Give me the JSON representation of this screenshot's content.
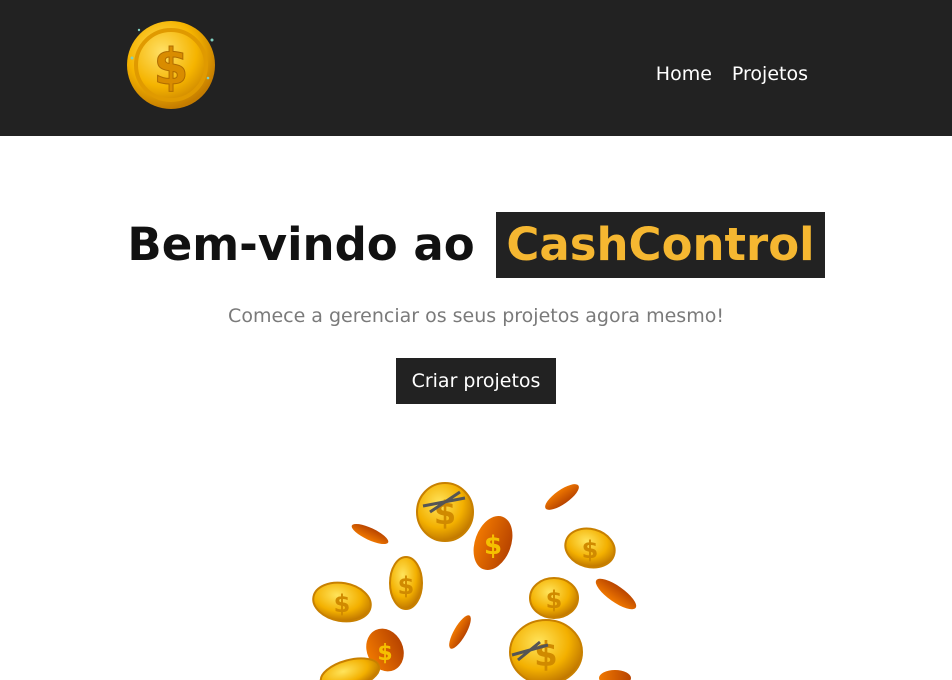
{
  "header": {
    "logo_icon": "gold-dollar-coin-icon",
    "nav": [
      {
        "label": "Home"
      },
      {
        "label": "Projetos"
      }
    ]
  },
  "hero": {
    "title_prefix": "Bem-vindo ao",
    "title_brand": "CashControl",
    "subtitle": "Comece a gerenciar os seus projetos agora mesmo!",
    "cta_label": "Criar projetos",
    "illustration_icon": "falling-coins-icon"
  },
  "colors": {
    "header_bg": "#222222",
    "brand_accent": "#f5b731",
    "text_dark": "#111111",
    "text_muted": "#7a7a7a"
  }
}
